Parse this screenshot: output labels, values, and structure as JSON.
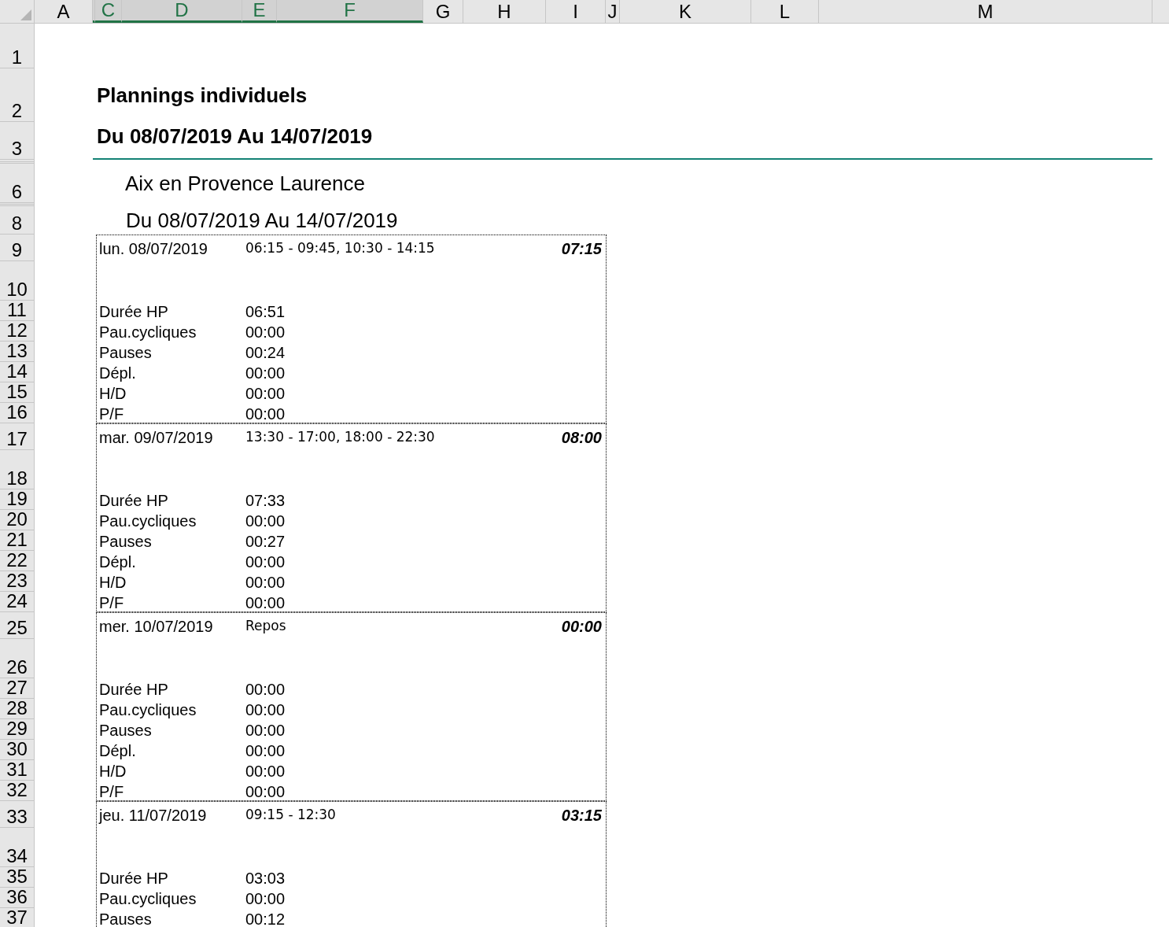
{
  "columns": [
    {
      "label": "A",
      "selected": false
    },
    {
      "label": "C",
      "selected": true
    },
    {
      "label": "D",
      "selected": true
    },
    {
      "label": "E",
      "selected": true
    },
    {
      "label": "F",
      "selected": true
    },
    {
      "label": "G",
      "selected": false
    },
    {
      "label": "H",
      "selected": false
    },
    {
      "label": "I",
      "selected": false
    },
    {
      "label": "J",
      "selected": false
    },
    {
      "label": "K",
      "selected": false
    },
    {
      "label": "L",
      "selected": false
    },
    {
      "label": "M",
      "selected": false
    }
  ],
  "rows": [
    "1",
    "2",
    "3",
    "6",
    "8",
    "9",
    "10",
    "11",
    "12",
    "13",
    "14",
    "15",
    "16",
    "17",
    "18",
    "19",
    "20",
    "21",
    "22",
    "23",
    "24",
    "25",
    "26",
    "27",
    "28",
    "29",
    "30",
    "31",
    "32",
    "33",
    "34",
    "35",
    "36",
    "37"
  ],
  "title": "Plannings individuels",
  "subtitle": "Du 08/07/2019 Au 14/07/2019",
  "person": "Aix en Provence Laurence",
  "period": "Du 08/07/2019 Au 14/07/2019",
  "days": [
    {
      "date": "lun. 08/07/2019",
      "shifts": "06:15 - 09:45, 10:30 - 14:15",
      "total": "07:15",
      "stats": [
        {
          "label": "Durée HP",
          "value": "06:51"
        },
        {
          "label": "Pau.cycliques",
          "value": "00:00"
        },
        {
          "label": "Pauses",
          "value": "00:24"
        },
        {
          "label": "Dépl.",
          "value": "00:00"
        },
        {
          "label": "H/D",
          "value": "00:00"
        },
        {
          "label": "P/F",
          "value": "00:00"
        }
      ]
    },
    {
      "date": "mar. 09/07/2019",
      "shifts": "13:30 - 17:00, 18:00 - 22:30",
      "total": "08:00",
      "stats": [
        {
          "label": "Durée HP",
          "value": "07:33"
        },
        {
          "label": "Pau.cycliques",
          "value": "00:00"
        },
        {
          "label": "Pauses",
          "value": "00:27"
        },
        {
          "label": "Dépl.",
          "value": "00:00"
        },
        {
          "label": "H/D",
          "value": "00:00"
        },
        {
          "label": "P/F",
          "value": "00:00"
        }
      ]
    },
    {
      "date": "mer. 10/07/2019",
      "shifts": "Repos",
      "total": "00:00",
      "stats": [
        {
          "label": "Durée HP",
          "value": "00:00"
        },
        {
          "label": "Pau.cycliques",
          "value": "00:00"
        },
        {
          "label": "Pauses",
          "value": "00:00"
        },
        {
          "label": "Dépl.",
          "value": "00:00"
        },
        {
          "label": "H/D",
          "value": "00:00"
        },
        {
          "label": "P/F",
          "value": "00:00"
        }
      ]
    },
    {
      "date": "jeu. 11/07/2019",
      "shifts": "09:15 - 12:30",
      "total": "03:15",
      "stats": [
        {
          "label": "Durée HP",
          "value": "03:03"
        },
        {
          "label": "Pau.cycliques",
          "value": "00:00"
        },
        {
          "label": "Pauses",
          "value": "00:12"
        }
      ]
    }
  ]
}
